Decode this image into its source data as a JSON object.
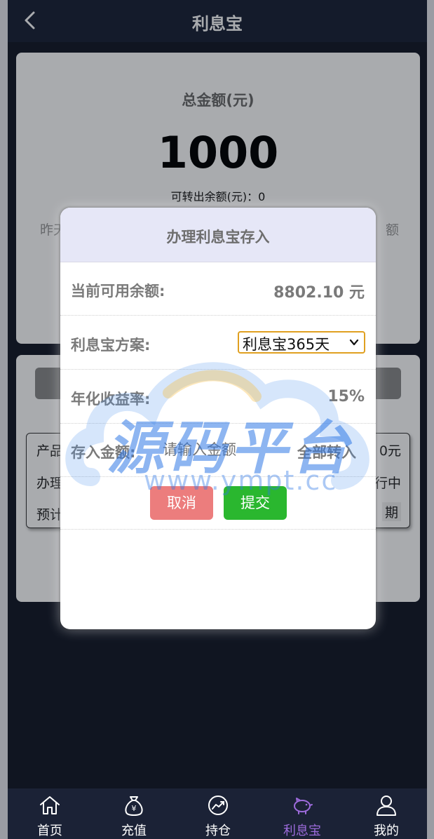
{
  "header": {
    "title": "利息宝"
  },
  "summary": {
    "total_label": "总金额(元)",
    "total_value": "1000",
    "transferable_label": "可转出余额(元)：",
    "transferable_value": "0",
    "partial_left": "昨天",
    "partial_right": "额"
  },
  "product_box": {
    "row1_left": "产品",
    "row1_right": "0元",
    "row2_left": "办理",
    "row2_right": "行中",
    "row3_left": "预计",
    "row3_right": "期"
  },
  "modal": {
    "title": "办理利息宝存入",
    "balance_label": "当前可用余额:",
    "balance_value": "8802.10 元",
    "plan_label": "利息宝方案:",
    "plan_selected": "利息宝365天",
    "rate_label": "年化收益率:",
    "rate_value": "15%",
    "amount_label": "存入金额:",
    "amount_placeholder": "请输入金额",
    "all_in_label": "全部转入",
    "cancel_label": "取消",
    "submit_label": "提交"
  },
  "watermark": {
    "text": "源码平台",
    "url": "www.ympt.cc"
  },
  "tabbar": {
    "items": [
      {
        "label": "首页",
        "icon": "home-icon"
      },
      {
        "label": "充值",
        "icon": "money-bag-icon"
      },
      {
        "label": "持仓",
        "icon": "trend-chart-icon"
      },
      {
        "label": "利息宝",
        "icon": "piggy-bank-icon"
      },
      {
        "label": "我的",
        "icon": "user-icon"
      }
    ],
    "active_index": 3,
    "active_color": "#9d6bdc"
  }
}
